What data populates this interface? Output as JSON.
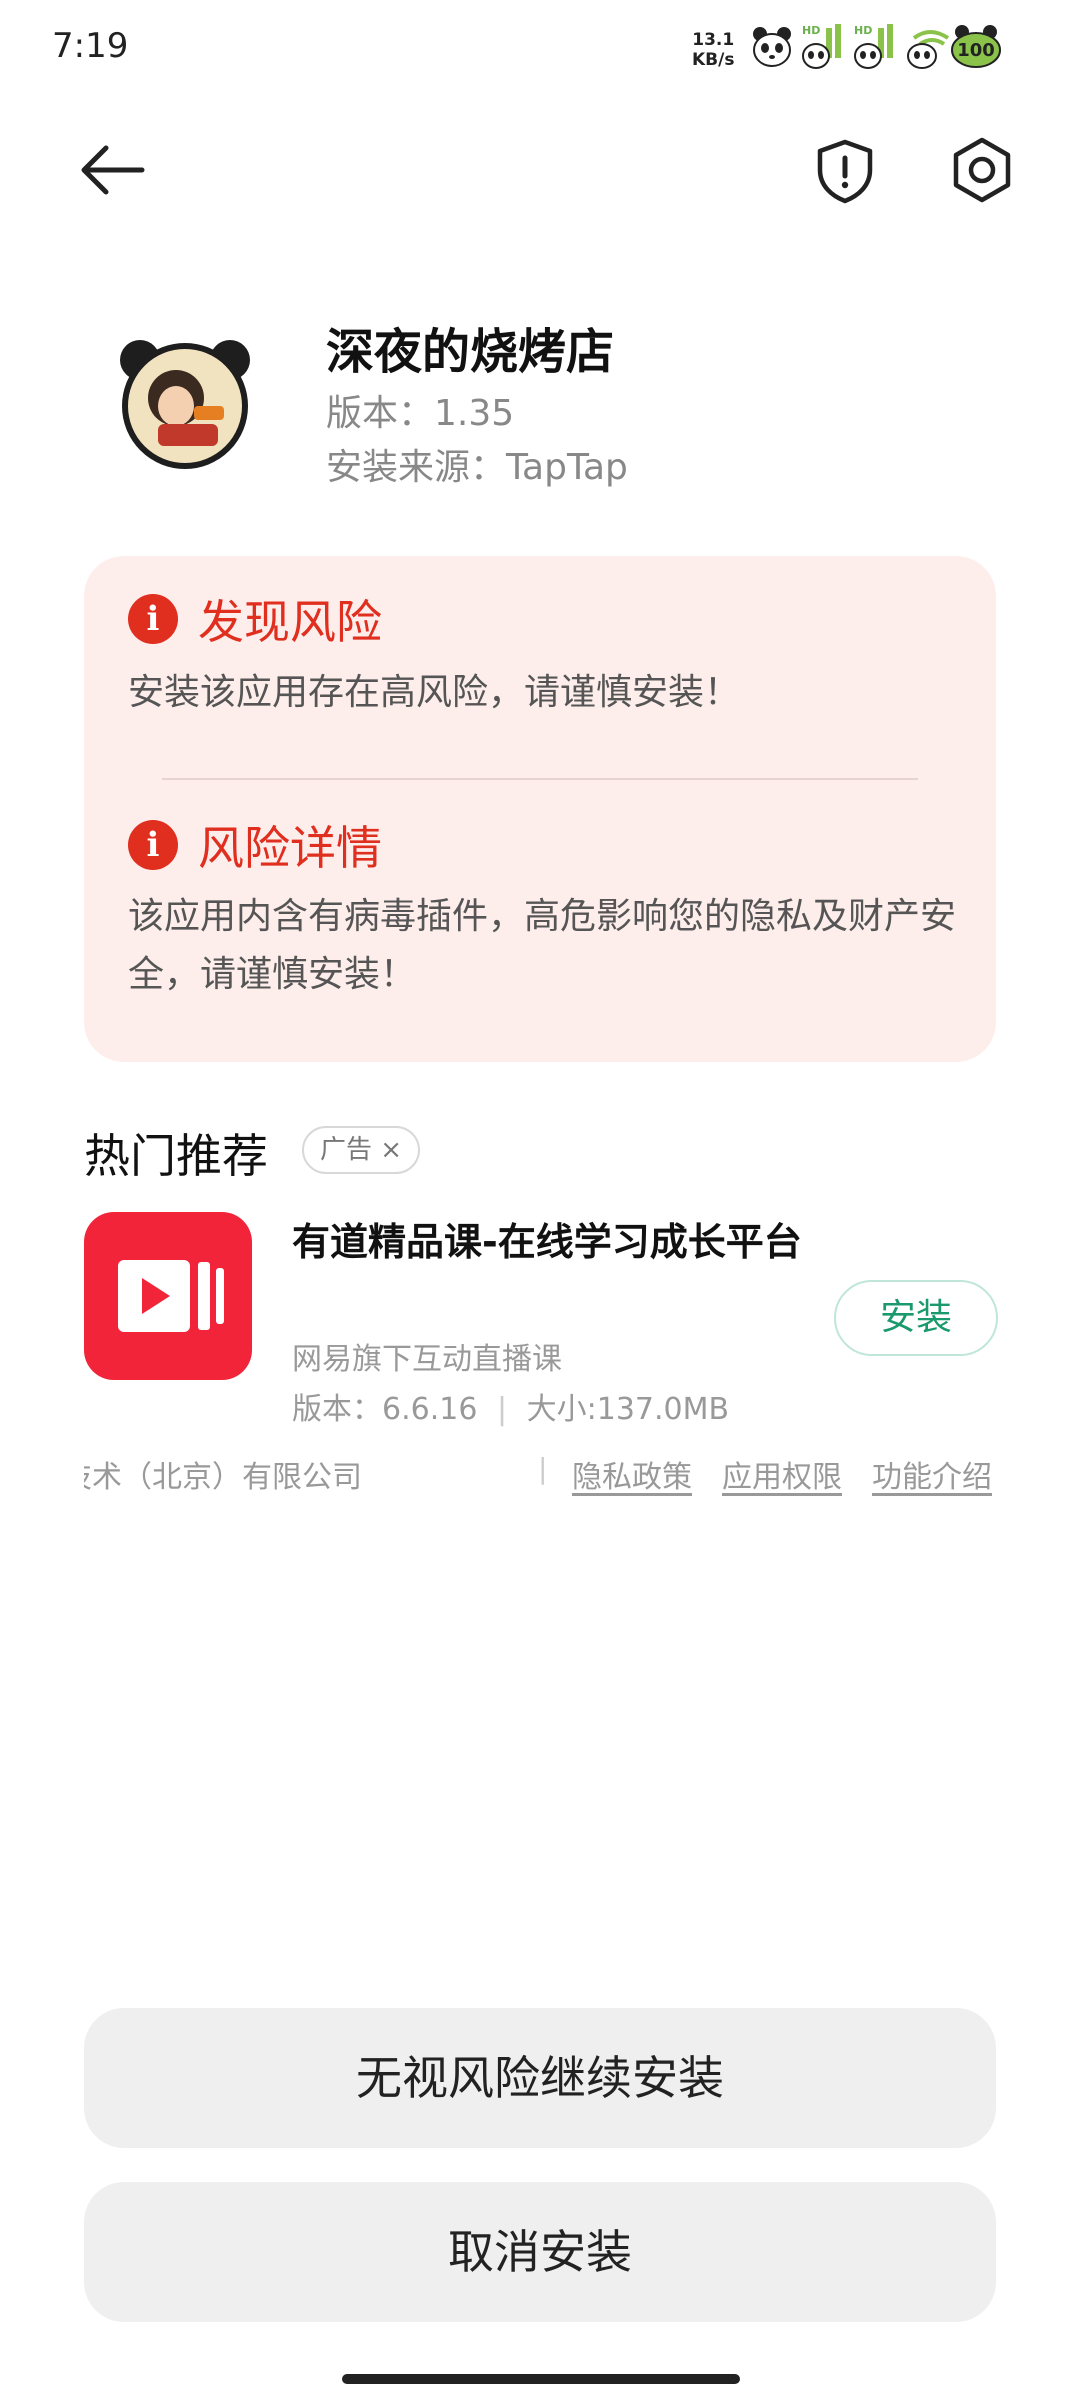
{
  "status_bar": {
    "time": "7:19",
    "net_speed_value": "13.1",
    "net_speed_unit": "KB/s",
    "icons": [
      "panda-icon",
      "hd-signal-icon",
      "hd-signal-icon",
      "wifi-icon",
      "battery-icon"
    ],
    "battery_level": "100"
  },
  "app": {
    "name": "深夜的烧烤店",
    "version": "版本：1.35",
    "source": "安装来源：TapTap"
  },
  "risk": {
    "found_title": "发现风险",
    "found_text": "安装该应用存在高风险，请谨慎安装！",
    "detail_title": "风险详情",
    "detail_text": "该应用内含有病毒插件，高危影响您的隐私及财产安全，请谨慎安装！",
    "icon_glyph": "i",
    "accent_color": "#e02e1f"
  },
  "recommend": {
    "title": "热门推荐",
    "ad_tag": "广告",
    "ad_close": "×",
    "item": {
      "name": "有道精品课-在线学习成长平台",
      "desc": "网易旗下互动直播课",
      "version": "版本：6.6.16",
      "size": "大小:137.0MB",
      "meta_sep": "|",
      "install_label": "安装"
    }
  },
  "footer": {
    "company": "技术（北京）有限公司",
    "sep": "|",
    "links": [
      "隐私政策",
      "应用权限",
      "功能介绍"
    ]
  },
  "buttons": {
    "continue_label": "无视风险继续安装",
    "cancel_label": "取消安装"
  }
}
